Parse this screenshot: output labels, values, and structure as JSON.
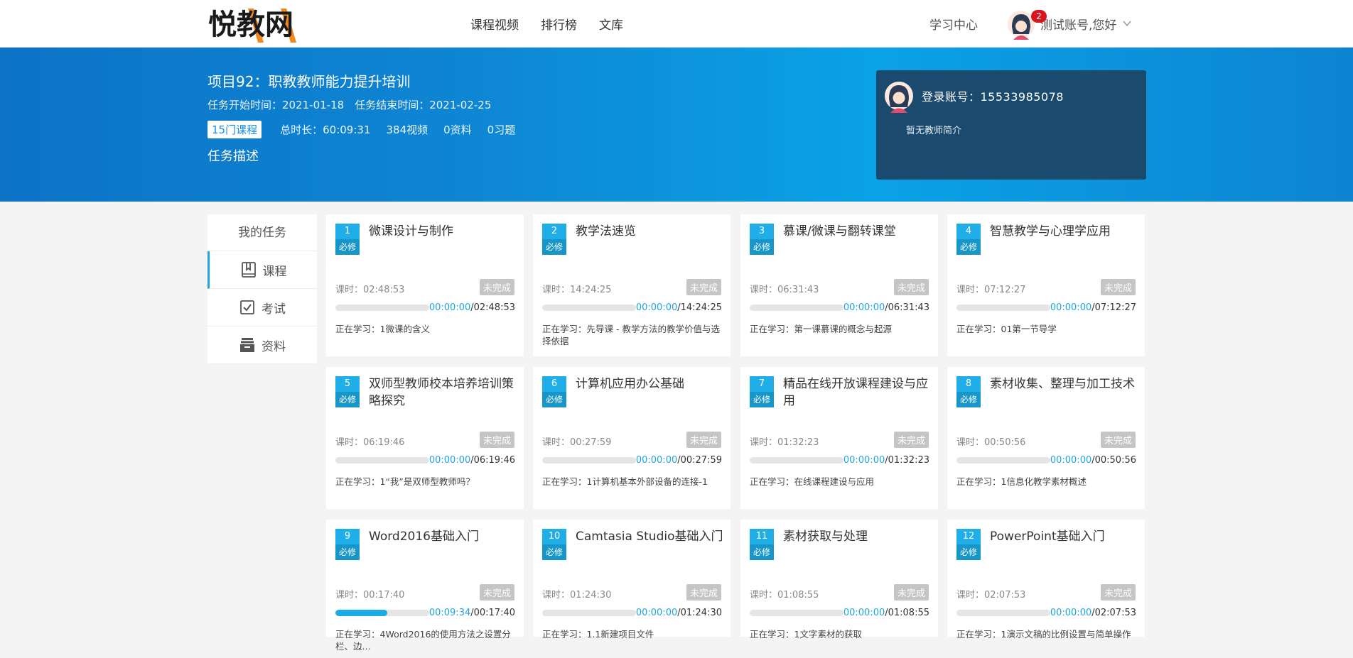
{
  "logo_text": "悦教网",
  "nav": {
    "items": [
      "课程视频",
      "排行榜",
      "文库"
    ]
  },
  "header": {
    "study_center": "学习中心",
    "notification_count": "2",
    "greeting": "测试账号,您好"
  },
  "project": {
    "title": "项目92：职教教师能力提升培训",
    "start": "任务开始时间：2021-01-18",
    "end": "任务结束时间：2021-02-25",
    "courses_pill": "15门课程",
    "total_label": "总时长：",
    "total_value": "60:09:31",
    "videos": "384视频",
    "materials": "0资料",
    "exercises": "0习题",
    "task_desc": "任务描述"
  },
  "teacher": {
    "account": "登录账号：15533985078",
    "intro": "暂无教师简介"
  },
  "sidebar": {
    "title": "我的任务",
    "items": [
      {
        "label": "课程",
        "icon": "book-icon"
      },
      {
        "label": "考试",
        "icon": "check-box-icon"
      },
      {
        "label": "资料",
        "icon": "archive-icon"
      }
    ]
  },
  "colors": {
    "accent": "#1faee8",
    "banner": "#0e86d3",
    "badge": "#d8141d",
    "status_gray": "#c5c5c5"
  },
  "courses": [
    {
      "num": "1",
      "req": "必修",
      "title": "微课设计与制作",
      "dur": "课时：02:48:53",
      "status": "未完成",
      "progress": 0,
      "cur": "00:00:00",
      "total": "/02:48:53",
      "learning": "正在学习：1微课的含义"
    },
    {
      "num": "2",
      "req": "必修",
      "title": "教学法速览",
      "dur": "课时：14:24:25",
      "status": "未完成",
      "progress": 0,
      "cur": "00:00:00",
      "total": "/14:24:25",
      "learning": "正在学习：先导课 - 教学方法的教学价值与选择依据"
    },
    {
      "num": "3",
      "req": "必修",
      "title": "慕课/微课与翻转课堂",
      "dur": "课时：06:31:43",
      "status": "未完成",
      "progress": 0,
      "cur": "00:00:00",
      "total": "/06:31:43",
      "learning": "正在学习：第一课慕课的概念与起源"
    },
    {
      "num": "4",
      "req": "必修",
      "title": "智慧教学与心理学应用",
      "dur": "课时：07:12:27",
      "status": "未完成",
      "progress": 0,
      "cur": "00:00:00",
      "total": "/07:12:27",
      "learning": "正在学习：01第一节导学"
    },
    {
      "num": "5",
      "req": "必修",
      "title": "双师型教师校本培养培训策略探究",
      "dur": "课时：06:19:46",
      "status": "未完成",
      "progress": 0,
      "cur": "00:00:00",
      "total": "/06:19:46",
      "learning": "正在学习：1“我”是双师型教师吗？"
    },
    {
      "num": "6",
      "req": "必修",
      "title": "计算机应用办公基础",
      "dur": "课时：00:27:59",
      "status": "未完成",
      "progress": 0,
      "cur": "00:00:00",
      "total": "/00:27:59",
      "learning": "正在学习：1计算机基本外部设备的连接-1"
    },
    {
      "num": "7",
      "req": "必修",
      "title": "精品在线开放课程建设与应用",
      "dur": "课时：01:32:23",
      "status": "未完成",
      "progress": 0,
      "cur": "00:00:00",
      "total": "/01:32:23",
      "learning": "正在学习：在线课程建设与应用"
    },
    {
      "num": "8",
      "req": "必修",
      "title": "素材收集、整理与加工技术",
      "dur": "课时：00:50:56",
      "status": "未完成",
      "progress": 0,
      "cur": "00:00:00",
      "total": "/00:50:56",
      "learning": "正在学习：1信息化教学素材概述"
    },
    {
      "num": "9",
      "req": "必修",
      "title": "Word2016基础入门",
      "dur": "课时：00:17:40",
      "status": "未完成",
      "progress": 0.55,
      "cur": "00:09:34",
      "total": "/00:17:40",
      "learning": "正在学习：4Word2016的使用方法之设置分栏、边..."
    },
    {
      "num": "10",
      "req": "必修",
      "title": "Camtasia Studio基础入门",
      "dur": "课时：01:24:30",
      "status": "未完成",
      "progress": 0,
      "cur": "00:00:00",
      "total": "/01:24:30",
      "learning": "正在学习：1.1新建项目文件"
    },
    {
      "num": "11",
      "req": "必修",
      "title": "素材获取与处理",
      "dur": "课时：01:08:55",
      "status": "未完成",
      "progress": 0,
      "cur": "00:00:00",
      "total": "/01:08:55",
      "learning": "正在学习：1文字素材的获取"
    },
    {
      "num": "12",
      "req": "必修",
      "title": "PowerPoint基础入门",
      "dur": "课时：02:07:53",
      "status": "未完成",
      "progress": 0,
      "cur": "00:00:00",
      "total": "/02:07:53",
      "learning": "正在学习：1演示文稿的比例设置与简单操作"
    }
  ]
}
